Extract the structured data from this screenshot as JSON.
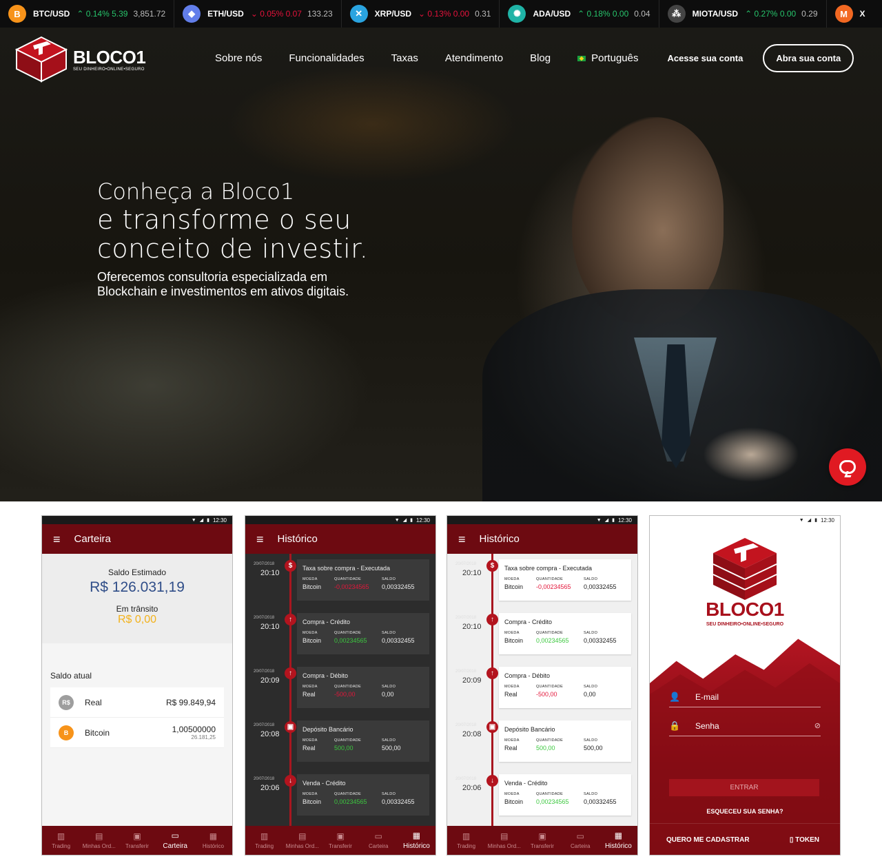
{
  "ticker": [
    {
      "icon": "B",
      "color": "#f7931a",
      "pair": "BTC/USD",
      "dir": "up",
      "change": "0.14% 5.39",
      "price": "3,851.72"
    },
    {
      "icon": "◆",
      "color": "#627eea",
      "pair": "ETH/USD",
      "dir": "down",
      "change": "0.05% 0.07",
      "price": "133.23"
    },
    {
      "icon": "✕",
      "color": "#2aa4e0",
      "pair": "XRP/USD",
      "dir": "down",
      "change": "0.13% 0.00",
      "price": "0.31"
    },
    {
      "icon": "✺",
      "color": "#1fb3a6",
      "pair": "ADA/USD",
      "dir": "up",
      "change": "0.18% 0.00",
      "price": "0.04"
    },
    {
      "icon": "⁂",
      "color": "#444444",
      "pair": "MIOTA/USD",
      "dir": "up",
      "change": "0.27% 0.00",
      "price": "0.29"
    },
    {
      "icon": "M",
      "color": "#f26822",
      "pair": "X",
      "dir": "",
      "change": "",
      "price": ""
    }
  ],
  "brand": {
    "name": "BLOCO1",
    "tagline": "SEU DINHEIRO•ONLINE•SEGURO"
  },
  "nav": {
    "items": [
      "Sobre nós",
      "Funcionalidades",
      "Taxas",
      "Atendimento",
      "Blog"
    ],
    "language": "Português",
    "login": "Acesse sua conta",
    "cta": "Abra sua conta"
  },
  "hero": {
    "line1": "Conheça a Bloco1",
    "line2": "e transforme o seu",
    "line3": "conceito de investir.",
    "sub1": "Oferecemos consultoria especializada em",
    "sub2": "Blockchain e investimentos em ativos digitais."
  },
  "status_time": "12:30",
  "bottom_nav": [
    "Trading",
    "Minhas Ord...",
    "Transferir",
    "Carteira",
    "Histórico"
  ],
  "carteira": {
    "title": "Carteira",
    "saldo_label": "Saldo Estimado",
    "saldo_value": "R$ 126.031,19",
    "transito_label": "Em trânsito",
    "transito_value": "R$ 0,00",
    "atual_label": "Saldo atual",
    "accounts": [
      {
        "icon": "R$",
        "color": "#9e9e9e",
        "name": "Real",
        "amount": "R$ 99.849,94",
        "sub": ""
      },
      {
        "icon": "B",
        "color": "#f7931a",
        "name": "Bitcoin",
        "amount": "1,00500000",
        "sub": "26.181,25"
      }
    ]
  },
  "historico": {
    "title": "Histórico",
    "col_labels": [
      "MOEDA",
      "QUANTIDADE",
      "SALDO"
    ],
    "entries": [
      {
        "date": "20/07/2018",
        "time": "20:10",
        "icon": "$",
        "title": "Taxa sobre compra - Executada",
        "moeda": "Bitcoin",
        "qtd": "-0,00234565",
        "sign": "neg",
        "saldo": "0,00332455"
      },
      {
        "date": "20/07/2018",
        "time": "20:10",
        "icon": "↑",
        "title": "Compra - Crédito",
        "moeda": "Bitcoin",
        "qtd": "0,00234565",
        "sign": "pos",
        "saldo": "0,00332455"
      },
      {
        "date": "20/07/2018",
        "time": "20:09",
        "icon": "↑",
        "title": "Compra - Débito",
        "moeda": "Real",
        "qtd": "-500,00",
        "sign": "neg",
        "saldo": "0,00"
      },
      {
        "date": "20/07/2018",
        "time": "20:08",
        "icon": "▣",
        "title": "Depósito Bancário",
        "moeda": "Real",
        "qtd": "500,00",
        "sign": "pos",
        "saldo": "500,00"
      },
      {
        "date": "20/07/2018",
        "time": "20:06",
        "icon": "↓",
        "title": "Venda - Crédito",
        "moeda": "Bitcoin",
        "qtd": "0,00234565",
        "sign": "pos",
        "saldo": "0,00332455"
      }
    ]
  },
  "login": {
    "brand": "BLOCO1",
    "tagline": "SEU DINHEIRO•ONLINE•SEGURO",
    "email_placeholder": "E-mail",
    "password_placeholder": "Senha",
    "submit": "ENTRAR",
    "forgot": "ESQUECEU SUA SENHA?",
    "register": "QUERO ME CADASTRAR",
    "token": "TOKEN"
  }
}
